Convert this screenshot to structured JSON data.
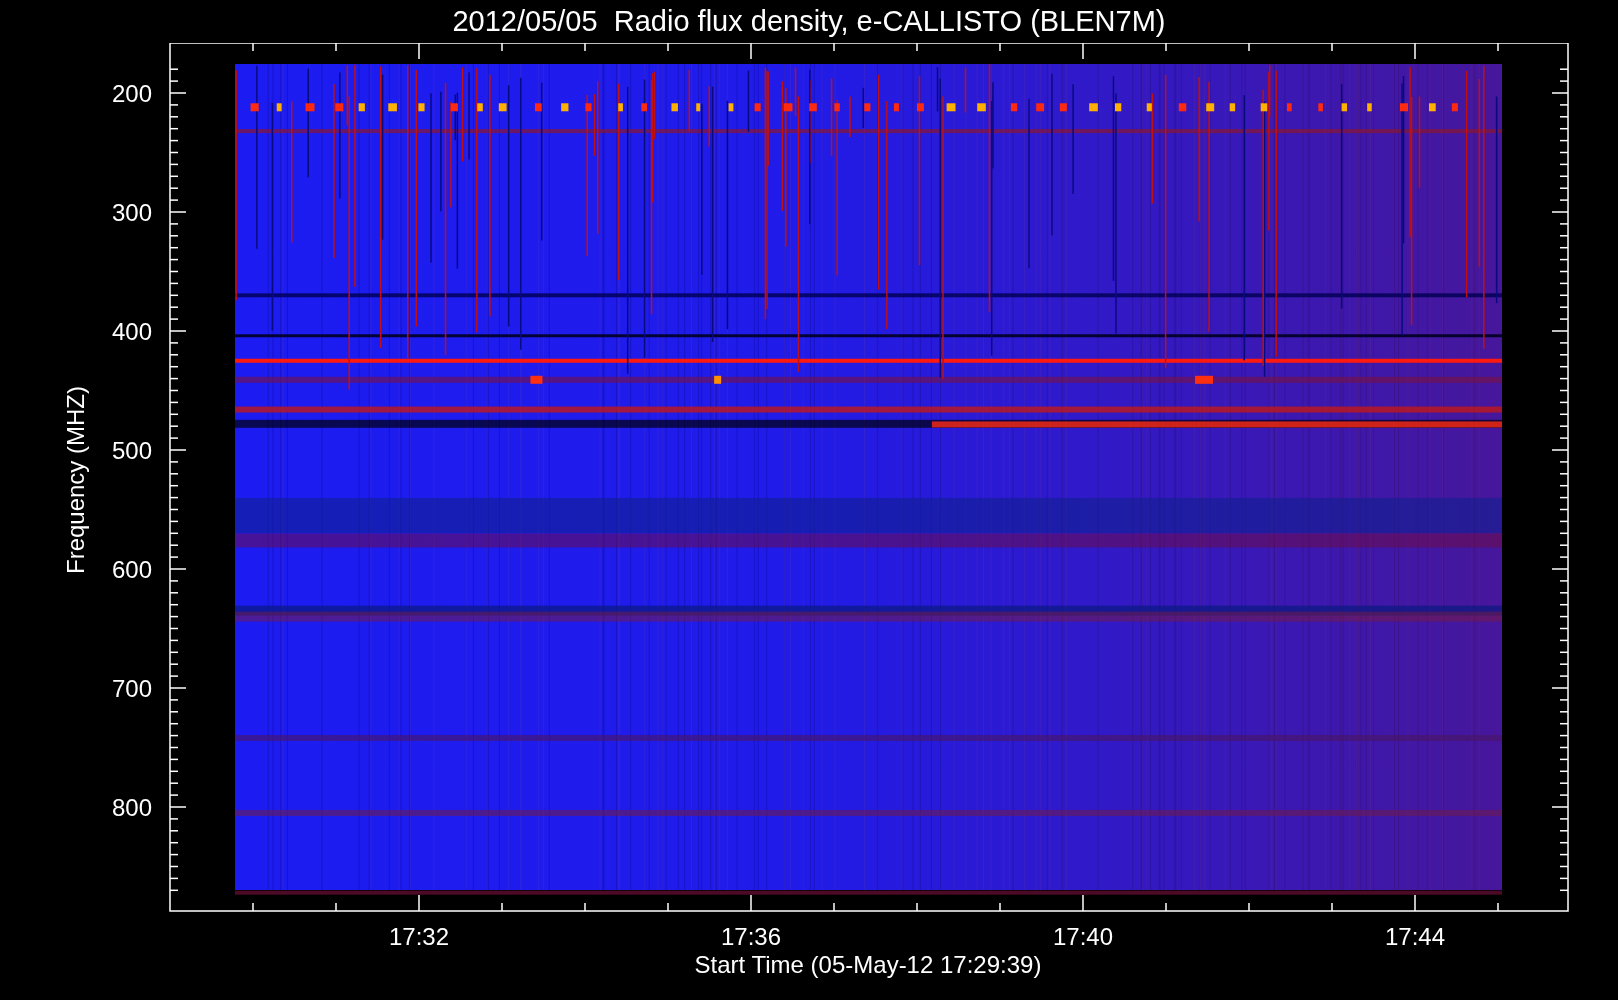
{
  "title": "2012/05/05  Radio flux density, e-CALLISTO (BLEN7M)",
  "y_axis": {
    "label": "Frequency (MHZ)",
    "ticks": [
      "200",
      "300",
      "400",
      "500",
      "600",
      "700",
      "800"
    ]
  },
  "x_axis": {
    "label": "Start Time (05-May-12 17:29:39)",
    "ticks": [
      "17:32",
      "17:36",
      "17:40",
      "17:44"
    ]
  }
}
